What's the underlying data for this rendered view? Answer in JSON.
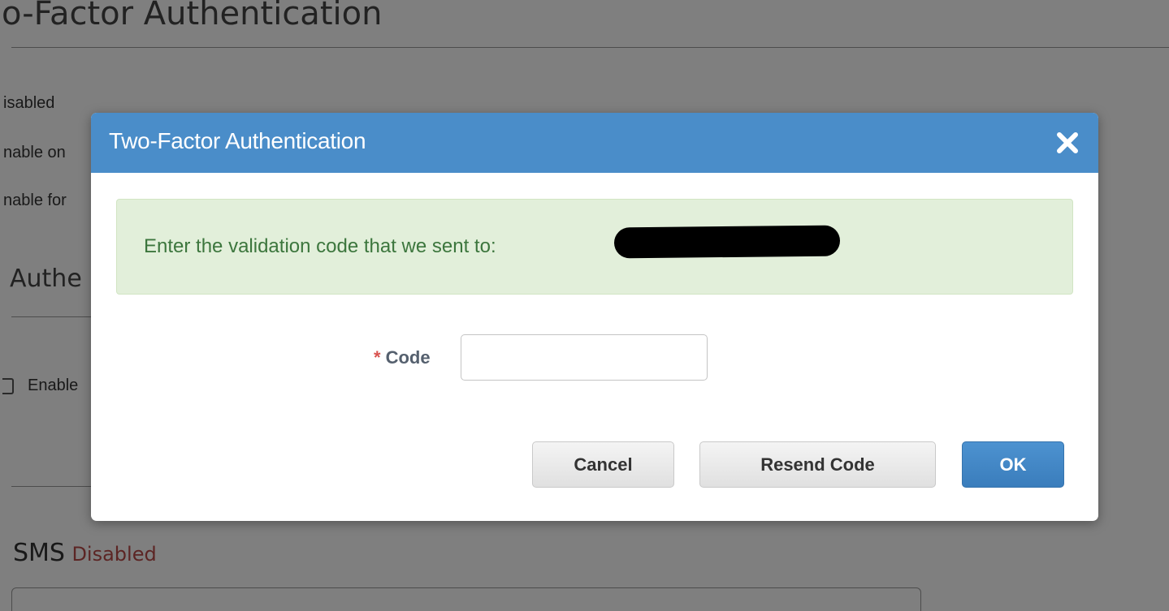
{
  "background": {
    "page_title": "o-Factor Authentication",
    "options": [
      "isabled",
      "nable on",
      "nable for"
    ],
    "section_heading": "Authe",
    "enable_label": "Enable",
    "sms_label": "SMS",
    "sms_status": "Disabled"
  },
  "modal": {
    "title": "Two-Factor Authentication",
    "close_icon": "close-icon",
    "alert_message": "Enter the validation code that we sent to:",
    "code_field": {
      "required_marker": "*",
      "label": "Code",
      "value": "",
      "placeholder": ""
    },
    "buttons": {
      "cancel": "Cancel",
      "resend": "Resend Code",
      "ok": "OK"
    }
  },
  "colors": {
    "header": "#4a8dc9",
    "alert_background": "#e2efda",
    "alert_text": "#3c763d",
    "required": "#d9534f",
    "primary_button": "#3a7dbc",
    "disabled_status": "#b94a48"
  }
}
